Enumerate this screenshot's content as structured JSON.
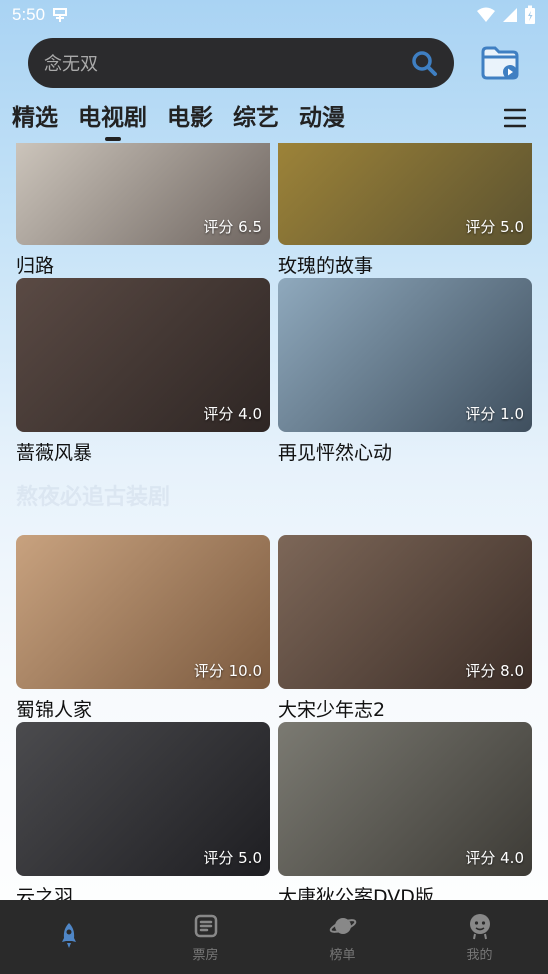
{
  "status": {
    "time": "5:50",
    "app_icon": "app-status-icon"
  },
  "search": {
    "placeholder": "念无双"
  },
  "tabs": [
    {
      "label": "精选",
      "active": false
    },
    {
      "label": "电视剧",
      "active": true
    },
    {
      "label": "电影",
      "active": false
    },
    {
      "label": "综艺",
      "active": false
    },
    {
      "label": "动漫",
      "active": false
    }
  ],
  "section_title": "熬夜必追古装剧",
  "cards": [
    {
      "title": "归路",
      "rating": "评分 6.5",
      "colors": [
        "#d9d2c8",
        "#6e6560"
      ]
    },
    {
      "title": "玫瑰的故事",
      "rating": "评分 5.0",
      "colors": [
        "#a68a3a",
        "#5b5230"
      ]
    },
    {
      "title": "蔷薇风暴",
      "rating": "评分 4.0",
      "colors": [
        "#5a4a44",
        "#2e2624"
      ]
    },
    {
      "title": "再见怦然心动",
      "rating": "评分 1.0",
      "colors": [
        "#8fa9bd",
        "#3f4f5e"
      ]
    },
    {
      "title": "蜀锦人家",
      "rating": "评分 10.0",
      "colors": [
        "#c8a27f",
        "#7b5a3f"
      ]
    },
    {
      "title": "大宋少年志2",
      "rating": "评分 8.0",
      "colors": [
        "#7d6758",
        "#3c2e28"
      ]
    },
    {
      "title": "云之羽",
      "rating": "评分 5.0",
      "colors": [
        "#4b4b4e",
        "#1e1e22"
      ]
    },
    {
      "title": "大唐狄公案DVD版",
      "rating": "评分 4.0",
      "colors": [
        "#7b7a72",
        "#3d3b36"
      ]
    }
  ],
  "bottom_nav": [
    {
      "label": "",
      "icon": "rocket-icon",
      "active": true
    },
    {
      "label": "票房",
      "icon": "ticket-icon",
      "active": false
    },
    {
      "label": "榜单",
      "icon": "planet-icon",
      "active": false
    },
    {
      "label": "我的",
      "icon": "profile-icon",
      "active": false
    }
  ],
  "colors": {
    "accent": "#3f7fc2",
    "nav_bg": "#2a2a2a",
    "search_bg": "#2b2b2d"
  }
}
